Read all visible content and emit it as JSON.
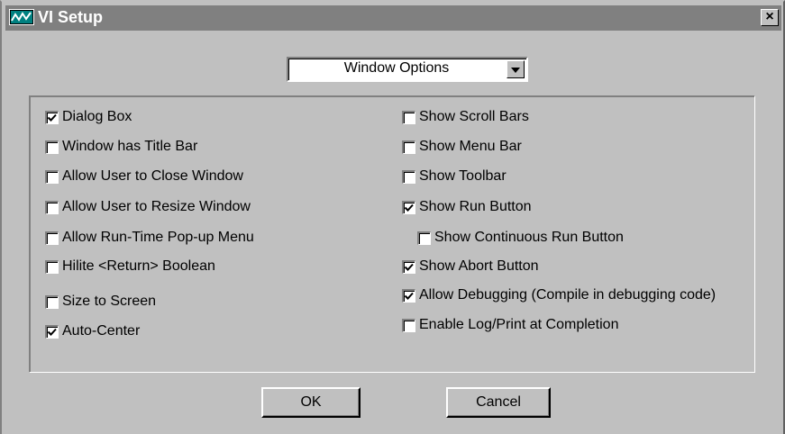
{
  "window": {
    "title": "VI Setup",
    "close_label": "×"
  },
  "category_dropdown": {
    "value": "Window Options"
  },
  "left_options": [
    {
      "label": "Dialog Box",
      "checked": true
    },
    {
      "label": "Window has Title Bar",
      "checked": false
    },
    {
      "label": "Allow User to Close Window",
      "checked": false
    },
    {
      "label": "Allow User to Resize Window",
      "checked": false
    },
    {
      "label": "Allow Run-Time Pop-up Menu",
      "checked": false
    },
    {
      "label": "Hilite <Return> Boolean",
      "checked": false
    },
    {
      "label": "Size to Screen",
      "checked": false
    },
    {
      "label": "Auto-Center",
      "checked": true
    }
  ],
  "right_options": [
    {
      "label": "Show Scroll Bars",
      "checked": false
    },
    {
      "label": "Show Menu Bar",
      "checked": false
    },
    {
      "label": "Show Toolbar",
      "checked": false
    },
    {
      "label": "Show Run Button",
      "checked": true
    },
    {
      "label": "Show Continuous Run Button",
      "checked": false
    },
    {
      "label": "Show Abort Button",
      "checked": true
    },
    {
      "label": "Allow Debugging (Compile in debugging code)",
      "checked": true
    },
    {
      "label": "Enable Log/Print at Completion",
      "checked": false
    }
  ],
  "buttons": {
    "ok": "OK",
    "cancel": "Cancel"
  },
  "colors": {
    "face": "#c0c0c0",
    "titlebar_inactive": "#808080",
    "title_text": "#ffffff"
  }
}
